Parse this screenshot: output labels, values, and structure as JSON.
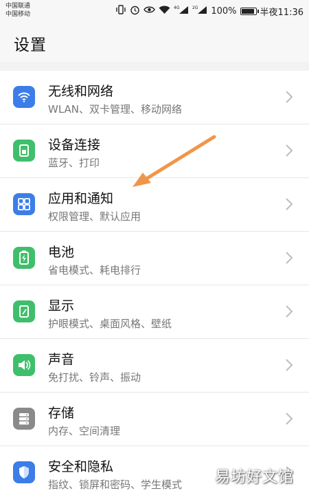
{
  "status_bar": {
    "carrier1": "中国联通",
    "carrier2": "中国移动",
    "signal1": "4G",
    "signal2": "2G",
    "battery": "100%",
    "time": "半夜11:36"
  },
  "header": {
    "title": "设置"
  },
  "items": [
    {
      "title": "无线和网络",
      "subtitle": "WLAN、双卡管理、移动网络",
      "icon": "wifi-icon",
      "color": "#3c7de8"
    },
    {
      "title": "设备连接",
      "subtitle": "蓝牙、打印",
      "icon": "device-connect-icon",
      "color": "#3fbf6b"
    },
    {
      "title": "应用和通知",
      "subtitle": "权限管理、默认应用",
      "icon": "apps-icon",
      "color": "#3c7de8"
    },
    {
      "title": "电池",
      "subtitle": "省电模式、耗电排行",
      "icon": "battery-icon",
      "color": "#3fbf6b"
    },
    {
      "title": "显示",
      "subtitle": "护眼模式、桌面风格、壁纸",
      "icon": "display-icon",
      "color": "#3fbf6b"
    },
    {
      "title": "声音",
      "subtitle": "免打扰、铃声、振动",
      "icon": "sound-icon",
      "color": "#3fbf6b"
    },
    {
      "title": "存储",
      "subtitle": "内存、空间清理",
      "icon": "storage-icon",
      "color": "#8a8a8a"
    },
    {
      "title": "安全和隐私",
      "subtitle": "指纹、锁屏和密码、学生模式",
      "icon": "shield-icon",
      "color": "#3c7de8"
    }
  ],
  "annotation": {
    "arrow_color": "#f0964a"
  },
  "watermark": "易坊好文馆"
}
